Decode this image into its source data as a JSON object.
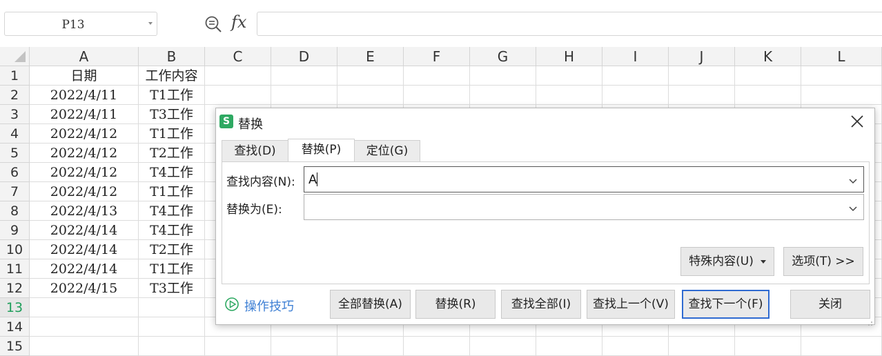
{
  "formula_bar": {
    "name_box": "P13",
    "zoom_icon": "zoom-search-icon",
    "fx_label": "fx",
    "formula": ""
  },
  "sheet": {
    "columns": [
      "A",
      "B",
      "C",
      "D",
      "E",
      "F",
      "G",
      "H",
      "I",
      "J",
      "K",
      "L"
    ],
    "rows": [
      "1",
      "2",
      "3",
      "4",
      "5",
      "6",
      "7",
      "8",
      "9",
      "10",
      "11",
      "12",
      "13",
      "14",
      "15"
    ],
    "active_row": "13",
    "cells": [
      [
        "日期",
        "工作内容"
      ],
      [
        "2022/4/11",
        "T1工作"
      ],
      [
        "2022/4/11",
        "T3工作"
      ],
      [
        "2022/4/12",
        "T1工作"
      ],
      [
        "2022/4/12",
        "T2工作"
      ],
      [
        "2022/4/12",
        "T4工作"
      ],
      [
        "2022/4/12",
        "T1工作"
      ],
      [
        "2022/4/13",
        "T4工作"
      ],
      [
        "2022/4/14",
        "T4工作"
      ],
      [
        "2022/4/14",
        "T2工作"
      ],
      [
        "2022/4/14",
        "T1工作"
      ],
      [
        "2022/4/15",
        "T3工作"
      ]
    ]
  },
  "dialog": {
    "logo": "S",
    "title": "替换",
    "tabs": [
      "查找(D)",
      "替换(P)",
      "定位(G)"
    ],
    "active_tab": 1,
    "find_label": "查找内容(N):",
    "find_value": "A",
    "replace_label": "替换为(E):",
    "replace_value": "",
    "special_button": "特殊内容(U)",
    "options_button": "选项(T) >>",
    "tips_label": "操作技巧",
    "buttons": {
      "replace_all": "全部替换(A)",
      "replace": "替换(R)",
      "find_all": "查找全部(I)",
      "find_prev": "查找上一个(V)",
      "find_next": "查找下一个(F)",
      "close": "关闭"
    },
    "colors": {
      "accent": "#2e6ad1",
      "logo": "#2ea962",
      "link": "#3d7fd4"
    }
  }
}
